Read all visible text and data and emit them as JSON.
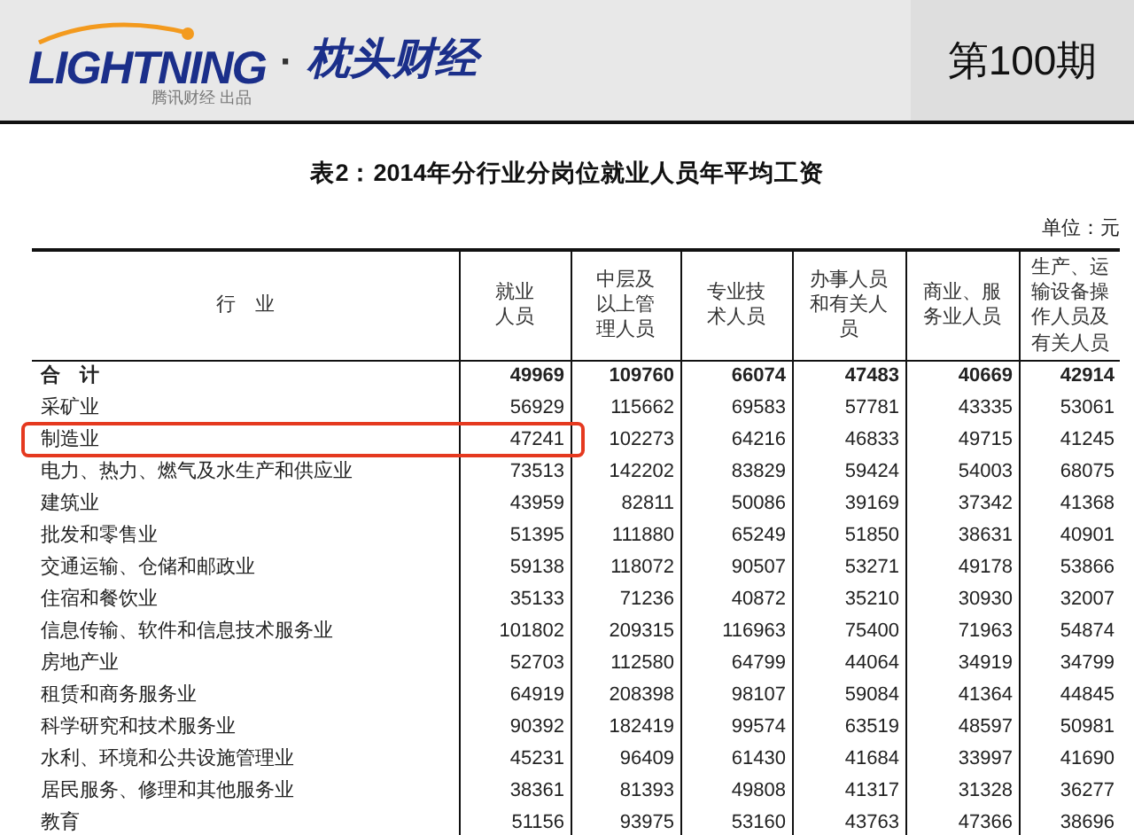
{
  "header": {
    "brand": "LIGHTNING",
    "separator": "·",
    "site_name": "枕头财经",
    "tagline": "腾讯财经 出品",
    "issue": "第100期"
  },
  "table": {
    "title": "表2：2014年分行业分岗位就业人员年平均工资",
    "unit": "单位：元",
    "columns": [
      "行　业",
      "就业人员",
      "中层及以上管理人员",
      "专业技术人员",
      "办事人员和有关人员",
      "商业、服务业人员",
      "生产、运输设备操作人员及有关人员"
    ],
    "rows": [
      {
        "kind": "total",
        "highlighted": false,
        "cells": [
          "合　计",
          "49969",
          "109760",
          "66074",
          "47483",
          "40669",
          "42914"
        ]
      },
      {
        "kind": "item",
        "highlighted": false,
        "cells": [
          "采矿业",
          "56929",
          "115662",
          "69583",
          "57781",
          "43335",
          "53061"
        ]
      },
      {
        "kind": "item",
        "highlighted": true,
        "cells": [
          "制造业",
          "47241",
          "102273",
          "64216",
          "46833",
          "49715",
          "41245"
        ]
      },
      {
        "kind": "item",
        "highlighted": false,
        "cells": [
          "电力、热力、燃气及水生产和供应业",
          "73513",
          "142202",
          "83829",
          "59424",
          "54003",
          "68075"
        ]
      },
      {
        "kind": "item",
        "highlighted": false,
        "cells": [
          "建筑业",
          "43959",
          "82811",
          "50086",
          "39169",
          "37342",
          "41368"
        ]
      },
      {
        "kind": "item",
        "highlighted": false,
        "cells": [
          "批发和零售业",
          "51395",
          "111880",
          "65249",
          "51850",
          "38631",
          "40901"
        ]
      },
      {
        "kind": "item",
        "highlighted": false,
        "cells": [
          "交通运输、仓储和邮政业",
          "59138",
          "118072",
          "90507",
          "53271",
          "49178",
          "53866"
        ]
      },
      {
        "kind": "item",
        "highlighted": false,
        "cells": [
          "住宿和餐饮业",
          "35133",
          "71236",
          "40872",
          "35210",
          "30930",
          "32007"
        ]
      },
      {
        "kind": "item",
        "highlighted": false,
        "cells": [
          "信息传输、软件和信息技术服务业",
          "101802",
          "209315",
          "116963",
          "75400",
          "71963",
          "54874"
        ]
      },
      {
        "kind": "item",
        "highlighted": false,
        "cells": [
          "房地产业",
          "52703",
          "112580",
          "64799",
          "44064",
          "34919",
          "34799"
        ]
      },
      {
        "kind": "item",
        "highlighted": false,
        "cells": [
          "租赁和商务服务业",
          "64919",
          "208398",
          "98107",
          "59084",
          "41364",
          "44845"
        ]
      },
      {
        "kind": "item",
        "highlighted": false,
        "cells": [
          "科学研究和技术服务业",
          "90392",
          "182419",
          "99574",
          "63519",
          "48597",
          "50981"
        ]
      },
      {
        "kind": "item",
        "highlighted": false,
        "cells": [
          "水利、环境和公共设施管理业",
          "45231",
          "96409",
          "61430",
          "41684",
          "33997",
          "41690"
        ]
      },
      {
        "kind": "item",
        "highlighted": false,
        "cells": [
          "居民服务、修理和其他服务业",
          "38361",
          "81393",
          "49808",
          "41317",
          "31328",
          "36277"
        ]
      },
      {
        "kind": "item",
        "highlighted": false,
        "cells": [
          "教育",
          "51156",
          "93975",
          "53160",
          "43763",
          "47366",
          "38696"
        ]
      }
    ]
  }
}
